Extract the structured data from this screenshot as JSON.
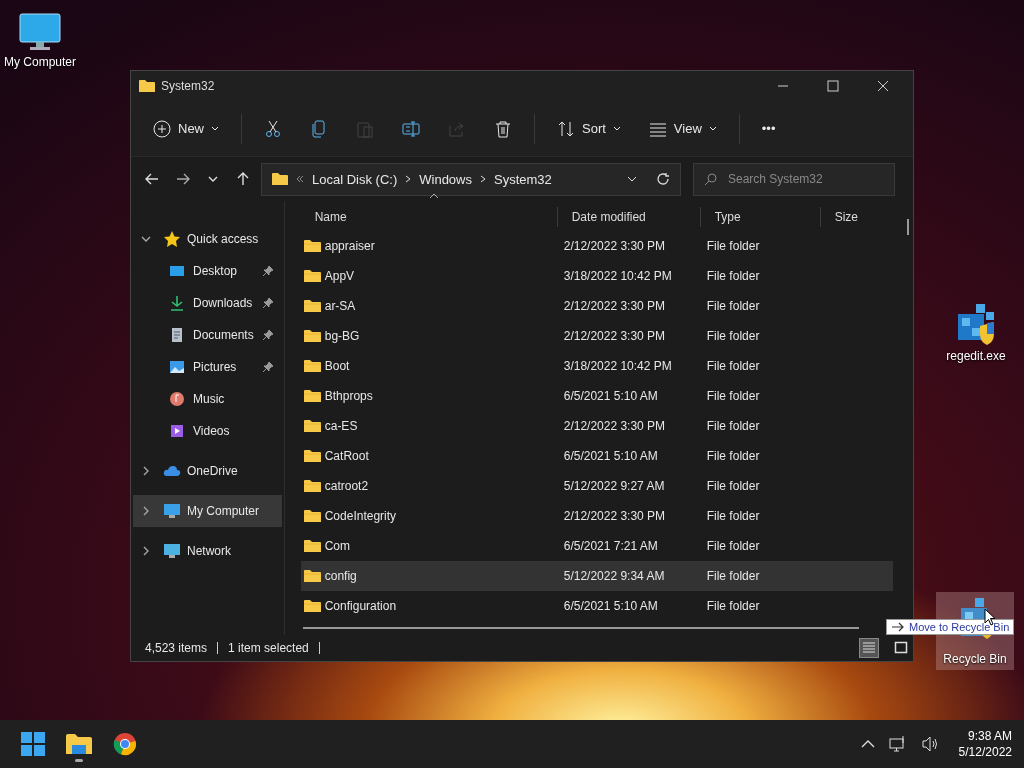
{
  "desktop_icons": [
    {
      "kind": "computer",
      "label": "My Computer",
      "selected": false
    },
    {
      "kind": "registry",
      "label": "regedit.exe",
      "selected": false
    },
    {
      "kind": "recycle",
      "label": "Recycle Bin",
      "selected": true
    }
  ],
  "window": {
    "title": "System32"
  },
  "toolbar": [
    {
      "kind": "new",
      "label": "New",
      "disabled": false
    },
    {
      "kind": "cut",
      "disabled": false
    },
    {
      "kind": "copy",
      "disabled": false
    },
    {
      "kind": "paste",
      "disabled": true
    },
    {
      "kind": "rename",
      "disabled": false
    },
    {
      "kind": "share",
      "disabled": true
    },
    {
      "kind": "delete",
      "disabled": false
    },
    {
      "kind": "sort",
      "label": "Sort",
      "disabled": false
    },
    {
      "kind": "view",
      "label": "View",
      "disabled": false
    },
    {
      "kind": "more",
      "label": "•••",
      "disabled": false
    }
  ],
  "address": {
    "path": [
      "Local Disk (C:)",
      "Windows",
      "System32"
    ]
  },
  "search": {
    "placeholder": "Search System32"
  },
  "sidebar": [
    {
      "kind": "star",
      "label": "Quick access",
      "expanded": true,
      "selected": false,
      "children": [
        {
          "kind": "desktop",
          "label": "Desktop",
          "pinned": true
        },
        {
          "kind": "download",
          "label": "Downloads",
          "pinned": true
        },
        {
          "kind": "document",
          "label": "Documents",
          "pinned": true
        },
        {
          "kind": "picture",
          "label": "Pictures",
          "pinned": true
        },
        {
          "kind": "music",
          "label": "Music",
          "pinned": false
        },
        {
          "kind": "video",
          "label": "Videos",
          "pinned": false
        }
      ]
    },
    {
      "kind": "cloud",
      "label": "OneDrive",
      "expanded": false,
      "selected": false
    },
    {
      "kind": "computer",
      "label": "My Computer",
      "expanded": false,
      "selected": true
    },
    {
      "kind": "network",
      "label": "Network",
      "expanded": false,
      "selected": false
    }
  ],
  "table": {
    "columns": [
      {
        "label": "Name",
        "sorted": true
      },
      {
        "label": "Date modified",
        "sorted": false
      },
      {
        "label": "Type",
        "sorted": false
      },
      {
        "label": "Size",
        "sorted": false
      }
    ],
    "rows": [
      {
        "name": "appraiser",
        "date": "2/12/2022 3:30 PM",
        "type": "File folder",
        "selected": false
      },
      {
        "name": "AppV",
        "date": "3/18/2022 10:42 PM",
        "type": "File folder",
        "selected": false
      },
      {
        "name": "ar-SA",
        "date": "2/12/2022 3:30 PM",
        "type": "File folder",
        "selected": false
      },
      {
        "name": "bg-BG",
        "date": "2/12/2022 3:30 PM",
        "type": "File folder",
        "selected": false
      },
      {
        "name": "Boot",
        "date": "3/18/2022 10:42 PM",
        "type": "File folder",
        "selected": false
      },
      {
        "name": "Bthprops",
        "date": "6/5/2021 5:10 AM",
        "type": "File folder",
        "selected": false
      },
      {
        "name": "ca-ES",
        "date": "2/12/2022 3:30 PM",
        "type": "File folder",
        "selected": false
      },
      {
        "name": "CatRoot",
        "date": "6/5/2021 5:10 AM",
        "type": "File folder",
        "selected": false
      },
      {
        "name": "catroot2",
        "date": "5/12/2022 9:27 AM",
        "type": "File folder",
        "selected": false
      },
      {
        "name": "CodeIntegrity",
        "date": "2/12/2022 3:30 PM",
        "type": "File folder",
        "selected": false
      },
      {
        "name": "Com",
        "date": "6/5/2021 7:21 AM",
        "type": "File folder",
        "selected": false
      },
      {
        "name": "config",
        "date": "5/12/2022 9:34 AM",
        "type": "File folder",
        "selected": true
      },
      {
        "name": "Configuration",
        "date": "6/5/2021 5:10 AM",
        "type": "File folder",
        "selected": false
      }
    ]
  },
  "status_bar": {
    "count": "4,523 items",
    "selection": "1 item selected",
    "views": [
      {
        "kind": "details",
        "selected": true
      },
      {
        "kind": "tiles",
        "selected": false
      }
    ]
  },
  "tooltip": {
    "text": "Move to Recycle Bin"
  },
  "taskbar": {
    "apps": [
      {
        "kind": "start",
        "running": false
      },
      {
        "kind": "explorer",
        "running": true
      },
      {
        "kind": "browser",
        "running": false
      }
    ],
    "time": "9:38 AM",
    "date": "5/12/2022"
  }
}
